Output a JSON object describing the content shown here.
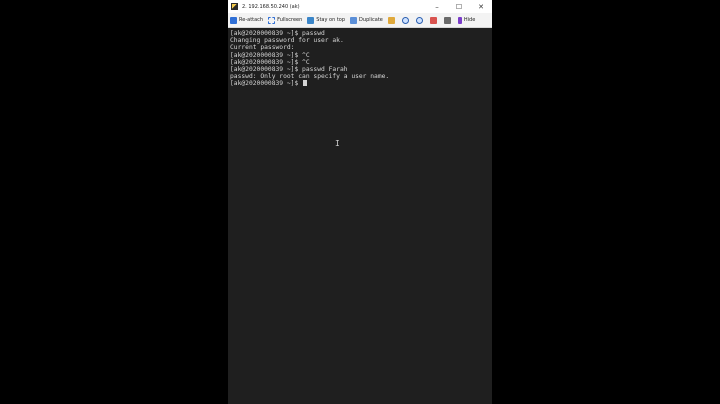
{
  "window": {
    "title": "2. 192.168.50.240 (ak)",
    "controls": [
      "–",
      "☐",
      "✕"
    ]
  },
  "toolbar": {
    "items": [
      {
        "label": "Re-attach",
        "icon": "reattach-icon"
      },
      {
        "label": "Fullscreen",
        "icon": "fullscreen-icon"
      },
      {
        "label": "Stay on top",
        "icon": "pin-icon"
      },
      {
        "label": "Duplicate",
        "icon": "duplicate-icon"
      },
      {
        "label": "",
        "icon": "edit-icon"
      },
      {
        "label": "",
        "icon": "zoom-in-icon"
      },
      {
        "label": "",
        "icon": "zoom-out-icon"
      },
      {
        "label": "",
        "icon": "mail-icon"
      },
      {
        "label": "",
        "icon": "print-icon"
      },
      {
        "label": "Hide",
        "icon": "bolt-icon"
      }
    ]
  },
  "terminal": {
    "lines": [
      "[ak@2020000839 ~]$ passwd",
      "Changing password for user ak.",
      "Current password:",
      "[ak@2020000839 ~]$ ^C",
      "[ak@2020000839 ~]$ ^C",
      "[ak@2020000839 ~]$ passwd Farah",
      "passwd: Only root can specify a user name.",
      "[ak@2020000839 ~]$ "
    ]
  },
  "colors": {
    "terminal_bg": "#1f1f1f",
    "terminal_fg": "#d4d4d4",
    "outer_bg": "#000000"
  }
}
